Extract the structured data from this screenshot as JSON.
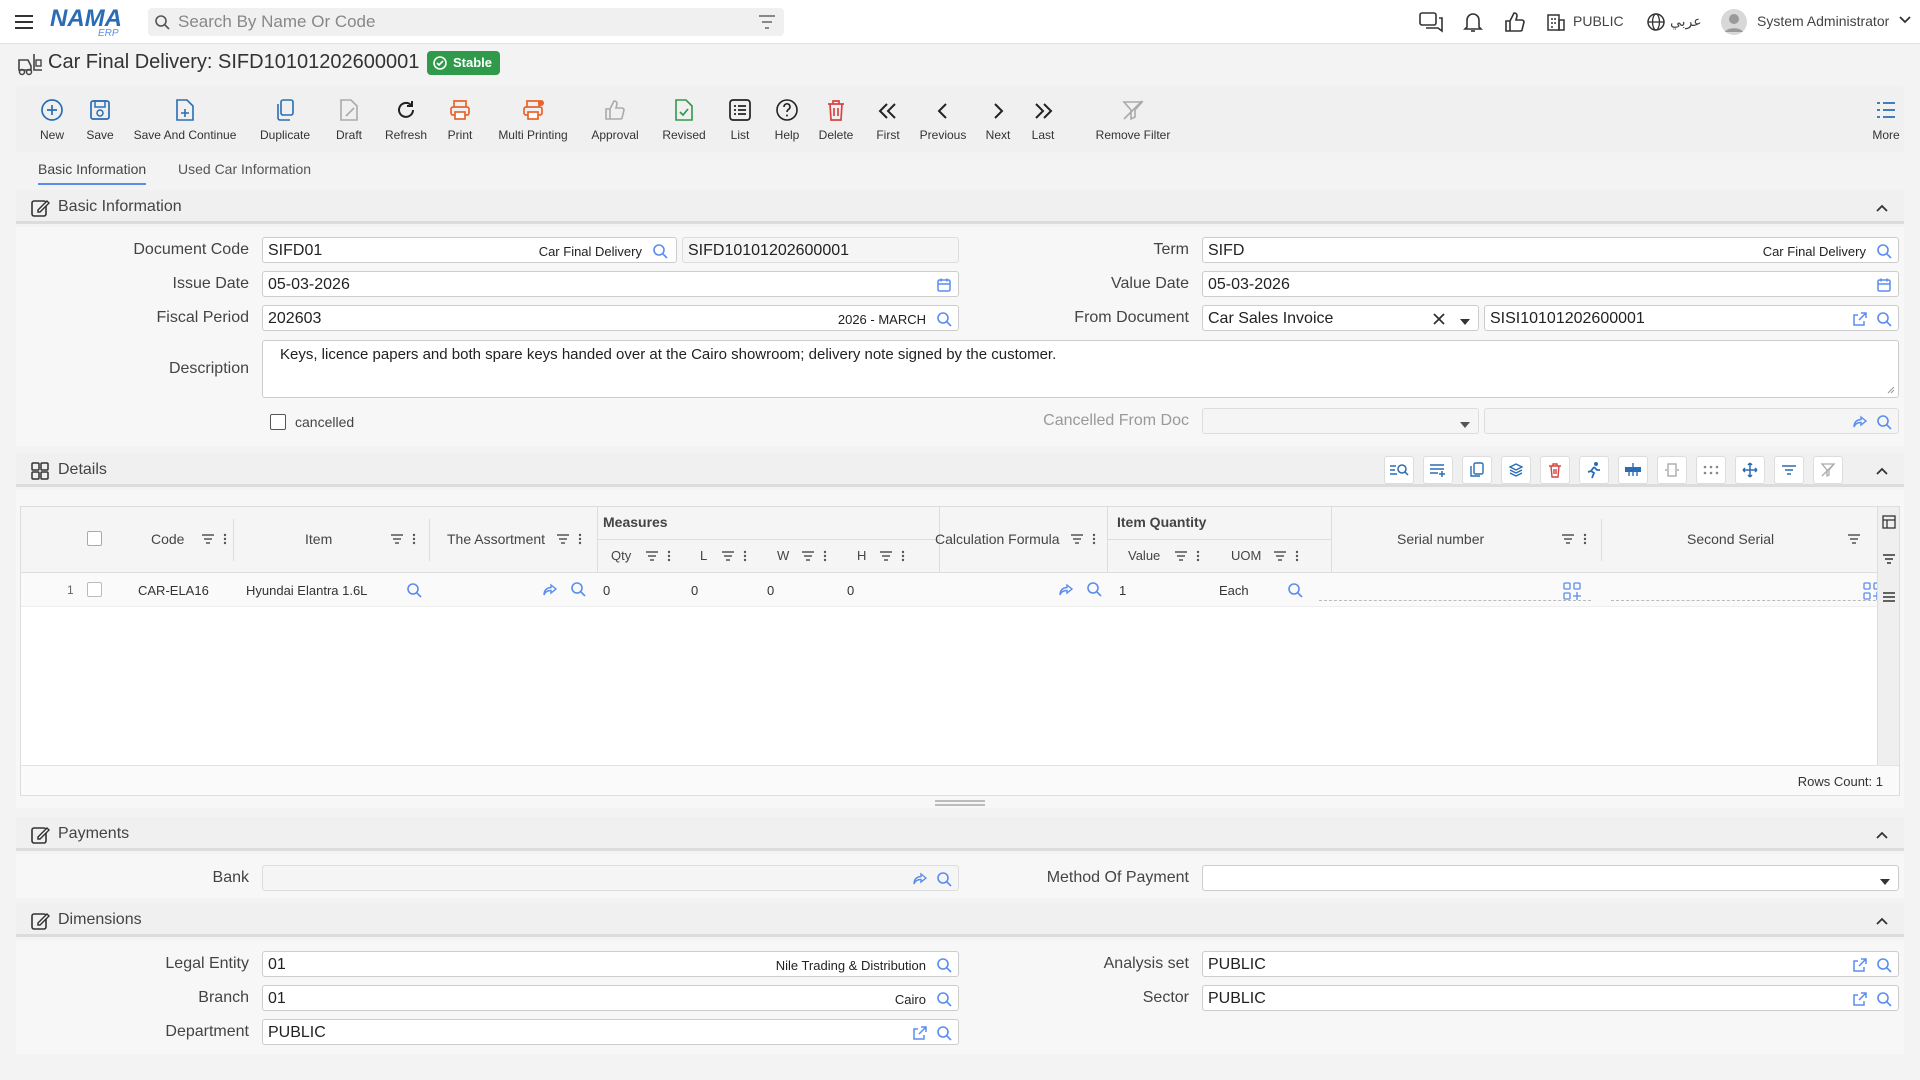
{
  "topbar": {
    "search_placeholder": "Search By Name Or Code",
    "branch_label": "PUBLIC",
    "language_label": "عربي",
    "user_name": "System Administrator"
  },
  "title": {
    "text": "Car Final Delivery: SIFD10101202600001",
    "status": "Stable"
  },
  "toolbar": [
    {
      "label": "New",
      "icon": "plus-circle-icon"
    },
    {
      "label": "Save",
      "icon": "save-icon"
    },
    {
      "label": "Save And Continue",
      "icon": "save-continue-icon"
    },
    {
      "label": "Duplicate",
      "icon": "duplicate-icon"
    },
    {
      "label": "Draft",
      "icon": "draft-icon"
    },
    {
      "label": "Refresh",
      "icon": "refresh-icon"
    },
    {
      "label": "Print",
      "icon": "print-icon"
    },
    {
      "label": "Multi Printing",
      "icon": "multi-print-icon"
    },
    {
      "label": "Approval",
      "icon": "thumbs-up-icon"
    },
    {
      "label": "Revised",
      "icon": "revised-icon"
    },
    {
      "label": "List",
      "icon": "list-icon"
    },
    {
      "label": "Help",
      "icon": "help-icon"
    },
    {
      "label": "Delete",
      "icon": "trash-icon"
    },
    {
      "label": "First",
      "icon": "double-chevron-left-icon"
    },
    {
      "label": "Previous",
      "icon": "chevron-left-icon"
    },
    {
      "label": "Next",
      "icon": "chevron-right-icon"
    },
    {
      "label": "Last",
      "icon": "double-chevron-right-icon"
    },
    {
      "label": "Remove Filter",
      "icon": "remove-filter-icon"
    },
    {
      "label": "More",
      "icon": "more-icon"
    }
  ],
  "tabs": [
    "Basic Information",
    "Used Car Information"
  ],
  "basic": {
    "section_title": "Basic Information",
    "document_code_label": "Document Code",
    "document_code": "SIFD01",
    "document_code_desc": "Car Final Delivery",
    "document_number": "SIFD10101202600001",
    "term_label": "Term",
    "term": "SIFD",
    "term_desc": "Car Final Delivery",
    "issue_date_label": "Issue Date",
    "issue_date": "05-03-2026",
    "value_date_label": "Value Date",
    "value_date": "05-03-2026",
    "fiscal_period_label": "Fiscal Period",
    "fiscal_period": "202603",
    "fiscal_period_desc": "2026 - MARCH",
    "from_document_label": "From Document",
    "from_document_type": "Car Sales Invoice",
    "from_document_code": "SISI10101202600001",
    "description_label": "Description",
    "description": "Keys, licence papers and both spare keys handed over at the Cairo showroom; delivery note signed by the customer.",
    "cancelled_label": "cancelled",
    "cancelled_from_doc_label": "Cancelled From Doc"
  },
  "details": {
    "section_title": "Details",
    "columns": {
      "code": "Code",
      "item": "Item",
      "assortment": "The Assortment",
      "measures": "Measures",
      "qty": "Qty",
      "l": "L",
      "w": "W",
      "h": "H",
      "formula": "Calculation Formula",
      "item_quantity": "Item Quantity",
      "value": "Value",
      "uom": "UOM",
      "serial": "Serial number",
      "second_serial": "Second Serial"
    },
    "rows": [
      {
        "num": "1",
        "code": "CAR-ELA16",
        "item": "Hyundai Elantra 1.6L",
        "qty": "0",
        "l": "0",
        "w": "0",
        "h": "0",
        "value": "1",
        "uom": "Each"
      }
    ],
    "rows_count": "Rows Count: 1"
  },
  "payments": {
    "section_title": "Payments",
    "bank_label": "Bank",
    "method_label": "Method Of Payment"
  },
  "dimensions": {
    "section_title": "Dimensions",
    "legal_entity_label": "Legal Entity",
    "legal_entity": "01",
    "legal_entity_desc": "Nile Trading & Distribution",
    "analysis_set_label": "Analysis set",
    "analysis_set": "PUBLIC",
    "branch_label": "Branch",
    "branch": "01",
    "branch_desc": "Cairo",
    "sector_label": "Sector",
    "sector": "PUBLIC",
    "department_label": "Department",
    "department": "PUBLIC"
  },
  "colors": {
    "accent": "#5b8def",
    "stable": "#2f9a4a",
    "danger": "#d64541",
    "print": "#e8632b",
    "nav_blue": "#2a6db5"
  }
}
